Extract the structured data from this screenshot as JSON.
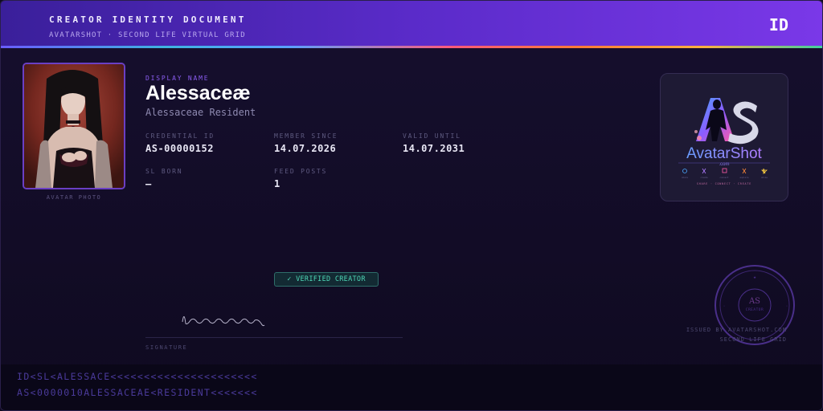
{
  "header": {
    "title": "CREATOR IDENTITY DOCUMENT",
    "subtitle": "AVATARSHOT · SECOND LIFE VIRTUAL GRID",
    "badge": "ID"
  },
  "photo": {
    "caption": "AVATAR PHOTO"
  },
  "identity": {
    "display_name_label": "DISPLAY NAME",
    "display_name": "Alessaceæ",
    "resident_name": "Alessaceae Resident"
  },
  "fields": [
    {
      "label": "CREDENTIAL ID",
      "value": "AS-00000152"
    },
    {
      "label": "MEMBER SINCE",
      "value": "14.07.2026"
    },
    {
      "label": "VALID UNTIL",
      "value": "14.07.2031"
    },
    {
      "label": "SL BORN",
      "value": "—"
    },
    {
      "label": "FEED POSTS",
      "value": "1"
    }
  ],
  "logo": {
    "monogram": "AS",
    "wordmark": "AvatarShot",
    "domain": ".com",
    "tagline": "SHARE · CONNECT · CREATE"
  },
  "verified": {
    "label": "✓ VERIFIED CREATOR"
  },
  "signature": {
    "label": "SIGNATURE"
  },
  "seal": {
    "monogram": "AS",
    "text": "CREATOR"
  },
  "issued": {
    "line1": "ISSUED BY AVATARSHOT.COM",
    "line2": "SECOND LIFE GRID"
  },
  "mrz": [
    "ID<SL<ALESSACE<<<<<<<<<<<<<<<<<<<<<<",
    "AS<0000010ALESSACEAE<RESIDENT<<<<<<<"
  ],
  "colors": {
    "header_start": "#3a1f9a",
    "header_end": "#7a38e8",
    "accent_purple": "#8a5cf0",
    "verified_green": "#4ed6b6",
    "card_bg": "#140e2a"
  }
}
